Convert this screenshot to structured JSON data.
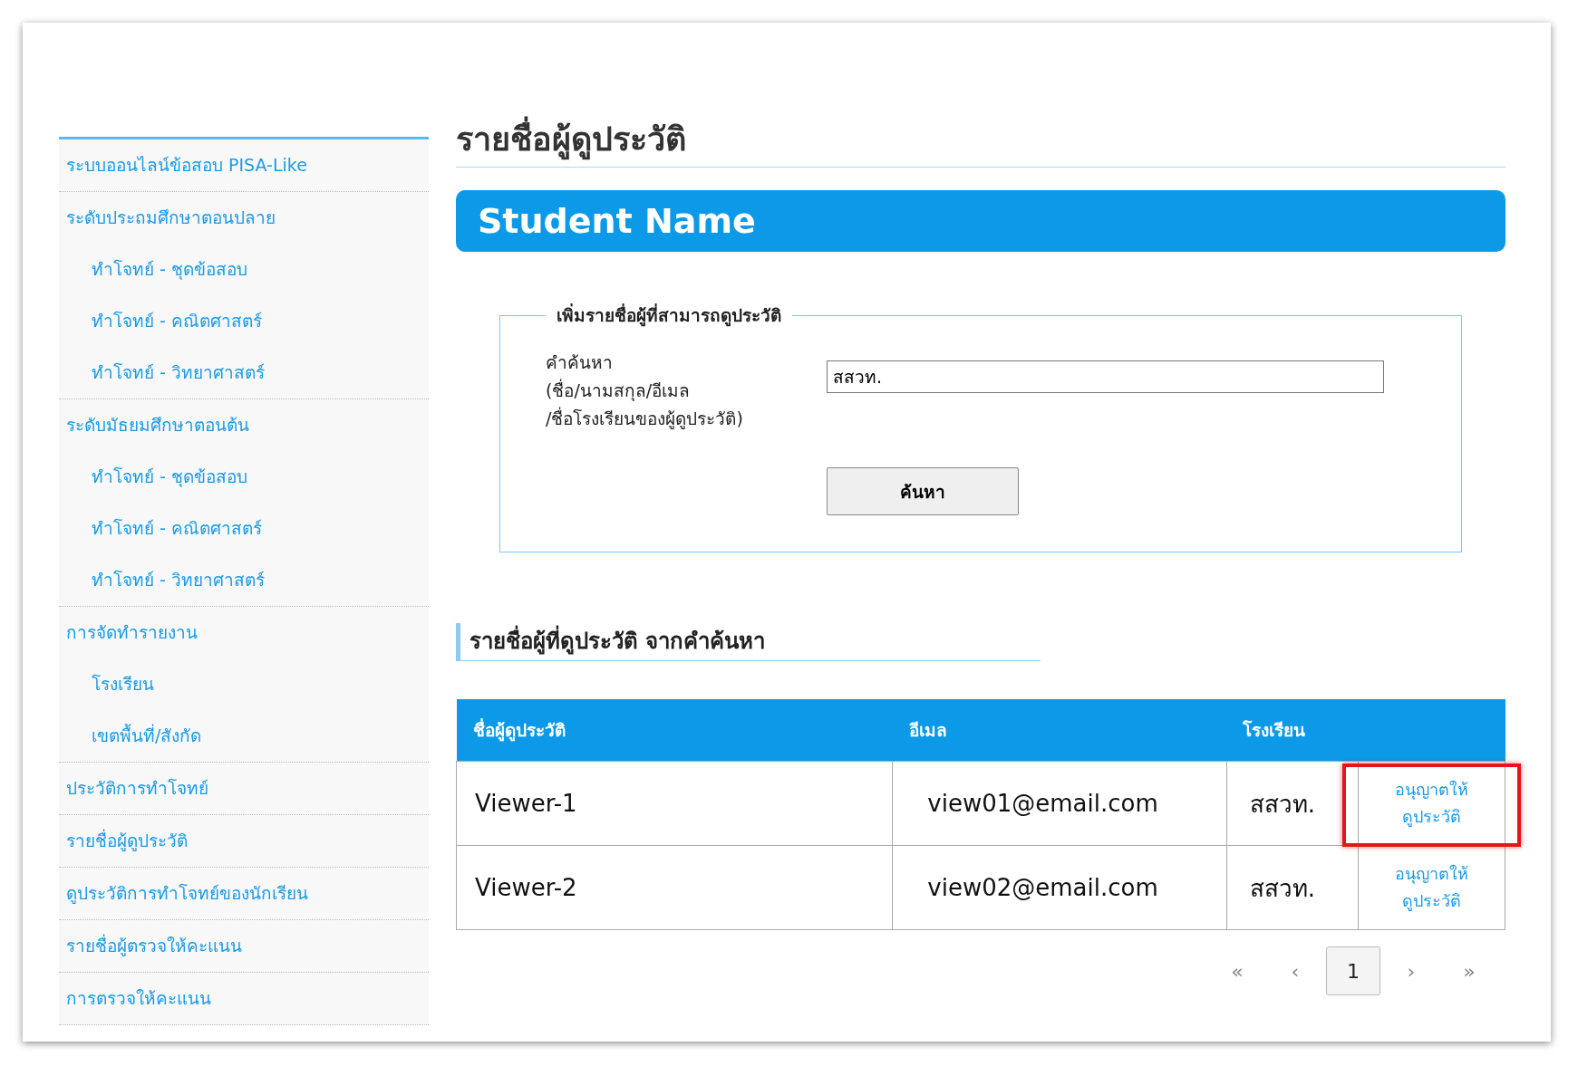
{
  "sidebar": {
    "items": [
      {
        "label": "ระบบออนไลน์ข้อสอบ PISA-Like"
      },
      {
        "label": "ระดับประถมศึกษาตอนปลาย",
        "children": [
          {
            "label": "ทำโจทย์ - ชุดข้อสอบ"
          },
          {
            "label": "ทำโจทย์ - คณิตศาสตร์"
          },
          {
            "label": "ทำโจทย์ - วิทยาศาสตร์"
          }
        ]
      },
      {
        "label": "ระดับมัธยมศึกษาตอนต้น",
        "children": [
          {
            "label": "ทำโจทย์ - ชุดข้อสอบ"
          },
          {
            "label": "ทำโจทย์ - คณิตศาสตร์"
          },
          {
            "label": "ทำโจทย์ - วิทยาศาสตร์"
          }
        ]
      },
      {
        "label": "การจัดทำรายงาน",
        "children": [
          {
            "label": "โรงเรียน"
          },
          {
            "label": "เขตพื้นที่/สังกัด"
          }
        ]
      },
      {
        "label": "ประวัติการทำโจทย์"
      },
      {
        "label": "รายชื่อผู้ดูประวัติ"
      },
      {
        "label": "ดูประวัติการทำโจทย์ของนักเรียน"
      },
      {
        "label": "รายชื่อผู้ตรวจให้คะแนน"
      },
      {
        "label": "การตรวจให้คะแนน"
      }
    ]
  },
  "page_title": "รายชื่อผู้ดูประวัติ",
  "banner": "Student Name",
  "search_form": {
    "legend": "เพิ่มรายชื่อผู้ที่สามารถดูประวัติ",
    "label_lines": [
      "คำค้นหา",
      "(ชื่อ/นามสกุล/อีเมล",
      "/ชื่อโรงเรียนของผู้ดูประวัติ)"
    ],
    "value": "สสวท.",
    "button": "ค้นหา"
  },
  "results_heading": "รายชื่อผู้ที่ดูประวัติ จากคำค้นหา",
  "table": {
    "columns": [
      "ชื่อผู้ดูประวัติ",
      "อีเมล",
      "โรงเรียน"
    ],
    "rows": [
      {
        "name": "Viewer-1",
        "email": "view01@email.com",
        "school": "สสวท.",
        "action": "อนุญาตให้ดูประวัติ",
        "highlighted": true
      },
      {
        "name": "Viewer-2",
        "email": "view02@email.com",
        "school": "สสวท.",
        "action": "อนุญาตให้ดูประวัติ",
        "highlighted": false
      }
    ]
  },
  "pagination": [
    {
      "label": "«",
      "selected": false
    },
    {
      "label": "‹",
      "selected": false
    },
    {
      "label": "1",
      "selected": true
    },
    {
      "label": "›",
      "selected": false
    },
    {
      "label": "»",
      "selected": false
    }
  ]
}
